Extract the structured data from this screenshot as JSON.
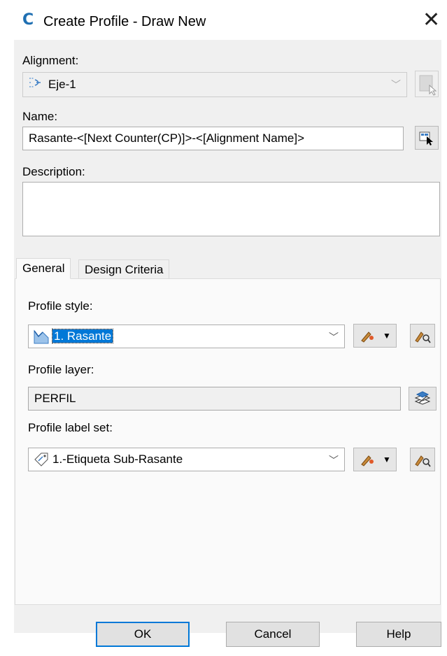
{
  "window": {
    "title": "Create Profile - Draw New",
    "app_icon": "C"
  },
  "alignment": {
    "label": "Alignment:",
    "value": "Eje-1",
    "icon": "alignment-icon"
  },
  "name": {
    "label": "Name:",
    "value": "Rasante-<[Next Counter(CP)]>-<[Alignment Name]>"
  },
  "description": {
    "label": "Description:",
    "value": ""
  },
  "tabs": [
    {
      "label": "General",
      "active": true
    },
    {
      "label": "Design Criteria",
      "active": false
    }
  ],
  "general": {
    "profile_style": {
      "label": "Profile style:",
      "value": "1. Rasante"
    },
    "profile_layer": {
      "label": "Profile layer:",
      "value": "PERFIL"
    },
    "profile_label_set": {
      "label": "Profile label set:",
      "value": "1.-Etiqueta Sub-Rasante"
    }
  },
  "buttons": {
    "ok": "OK",
    "cancel": "Cancel",
    "help": "Help"
  },
  "colors": {
    "accent": "#0078d7",
    "dialog_bg": "#f0f0f0"
  }
}
